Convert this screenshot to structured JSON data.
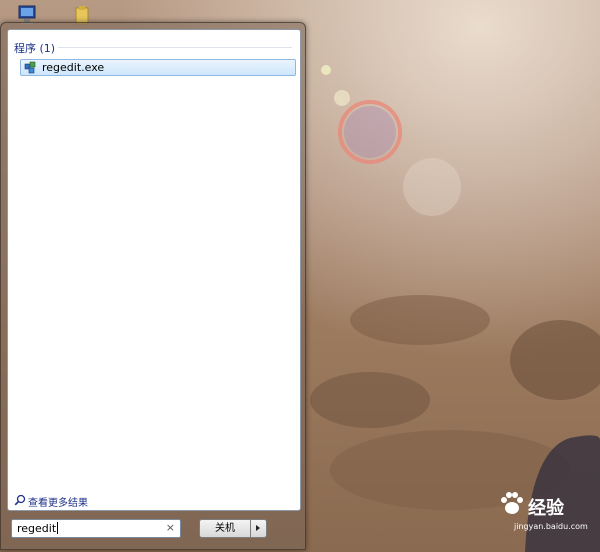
{
  "start_menu": {
    "group_header": "程序 (1)",
    "results": [
      {
        "label": "regedit.exe",
        "icon": "registry-editor-icon"
      }
    ],
    "see_more": "查看更多结果",
    "search": {
      "value": "regedit",
      "clear_glyph": "×"
    },
    "shutdown_label": "关机"
  },
  "watermark": {
    "brand": "经验",
    "domain": "jingyan.baidu.com"
  },
  "colors": {
    "accent_text": "#1e3287",
    "selection_border": "#8fb7e1",
    "selection_fill": "#cde6fb"
  }
}
